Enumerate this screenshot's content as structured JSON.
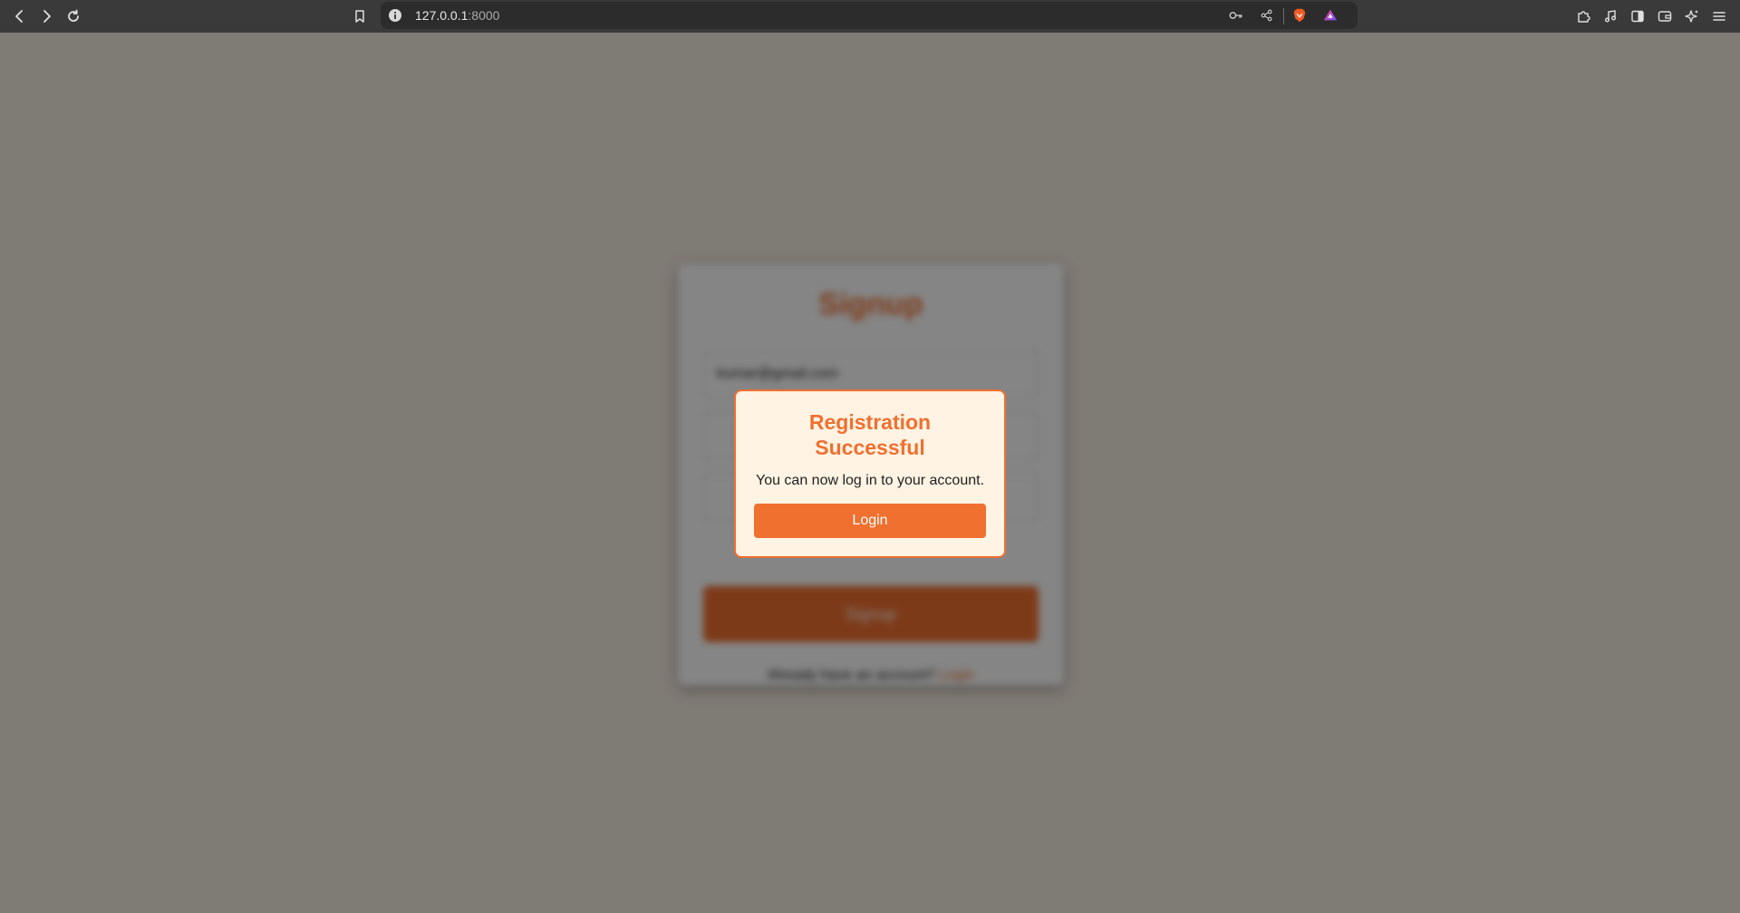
{
  "browser": {
    "url_host": "127.0.0.1",
    "url_port": ":8000",
    "nav_icons": [
      "back-icon",
      "forward-icon",
      "reload-icon",
      "bookmark-icon"
    ],
    "url_icons": [
      "key-icon",
      "share-icon",
      "brave-shields-icon",
      "brave-rewards-icon"
    ],
    "right_icons": [
      "extensions-icon",
      "media-icon",
      "sidebar-icon",
      "wallet-icon",
      "leo-ai-icon",
      "menu-icon"
    ]
  },
  "signup": {
    "title": "Signup",
    "email_value": "kumar@gmail.com",
    "submit_label": "Signup",
    "footer_text": "Already have an account?",
    "footer_link": "Login"
  },
  "modal": {
    "title": "Registration Successful",
    "message": "You can now log in to your account.",
    "button_label": "Login"
  },
  "colors": {
    "accent": "#f07030",
    "modal_bg": "#fff3e3"
  }
}
